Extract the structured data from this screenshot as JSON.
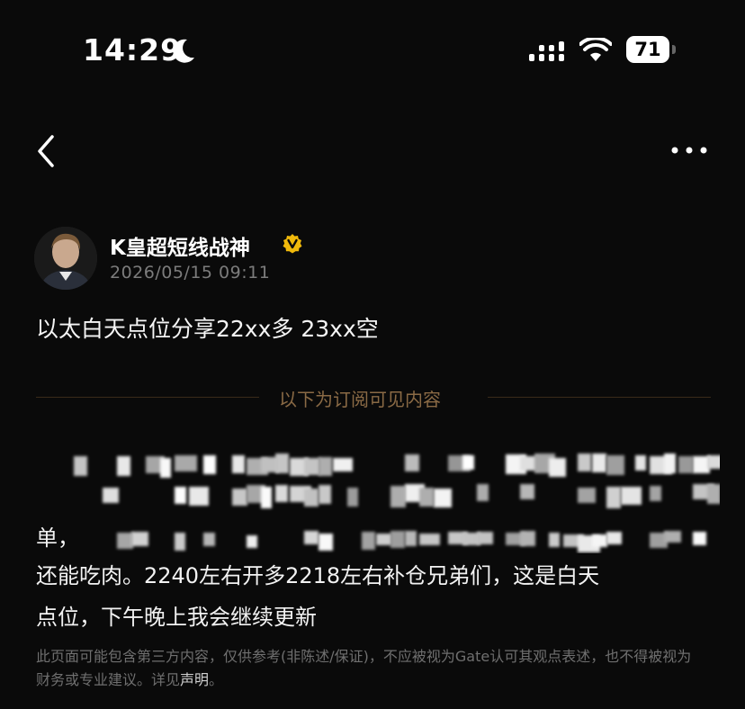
{
  "status": {
    "time": "14:29",
    "battery": "71"
  },
  "post": {
    "author": "K皇超短线战神",
    "timestamp": "2026/05/15 09:11",
    "title": "以太白天点位分享22xx多 23xx空",
    "subscribe_divider": "以下为订阅可见内容",
    "partial_line": "单，",
    "body_line_1": "还能吃肉。2240左右开多2218左右补仓兄弟们，这是白天",
    "body_line_2": "点位，下午晚上我会继续更新"
  },
  "disclaimer": {
    "text": "此页面可能包含第三方内容，仅供参考(非陈述/保证)，不应被视为Gate认可其观点表述，也不得被视为财务或专业建议。详见",
    "link": "声明",
    "end": "。"
  },
  "colors": {
    "background": "#0a0a0a",
    "verified": "#f0b90b",
    "divider": "#8a6a45"
  }
}
